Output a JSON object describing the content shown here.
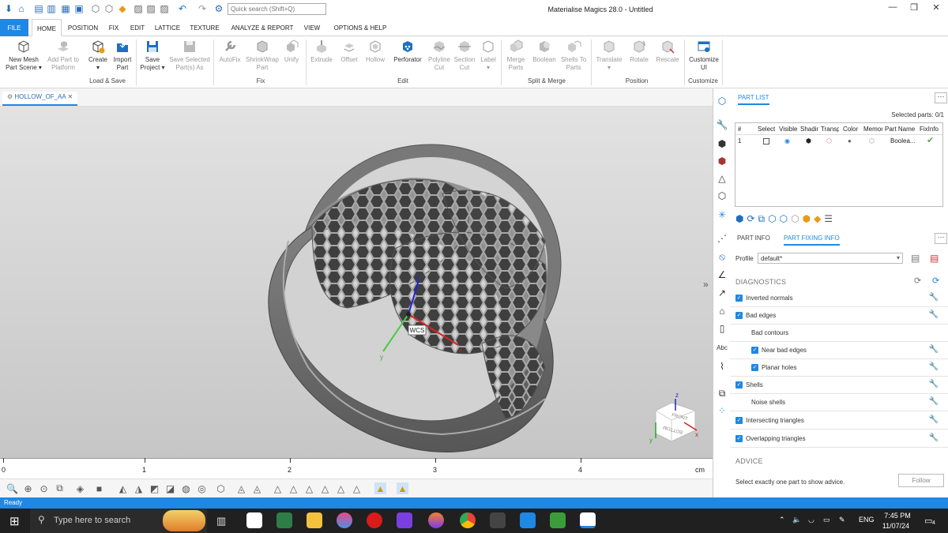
{
  "titlebar": {
    "title": "Materialise Magics 28.0 - Untitled",
    "search_placeholder": "Quick search (Shift+Q)",
    "minimize": "—",
    "restore": "❐",
    "close": "✕"
  },
  "tabs": [
    "FILE",
    "HOME",
    "POSITION",
    "FIX",
    "EDIT",
    "LATTICE",
    "TEXTURE",
    "ANALYZE & REPORT",
    "VIEW",
    "OPTIONS & HELP"
  ],
  "ribbon": {
    "buttons": [
      {
        "line1": "New Mesh",
        "line2": "Part Scene ▾"
      },
      {
        "line1": "Add Part to",
        "line2": "Platform"
      },
      {
        "line1": "Create",
        "line2": "▾"
      },
      {
        "line1": "Import",
        "line2": "Part"
      },
      {
        "line1": "Save",
        "line2": "Project ▾"
      },
      {
        "line1": "Save Selected",
        "line2": "Part(s) As"
      },
      {
        "line1": "AutoFix",
        "line2": ""
      },
      {
        "line1": "ShrinkWrap",
        "line2": "Part"
      },
      {
        "line1": "Unify",
        "line2": ""
      },
      {
        "line1": "Extrude",
        "line2": ""
      },
      {
        "line1": "Offset",
        "line2": ""
      },
      {
        "line1": "Hollow",
        "line2": ""
      },
      {
        "line1": "Perforator",
        "line2": ""
      },
      {
        "line1": "Polyline",
        "line2": "Cut"
      },
      {
        "line1": "Section",
        "line2": "Cut"
      },
      {
        "line1": "Label",
        "line2": "▾"
      },
      {
        "line1": "Merge",
        "line2": "Parts"
      },
      {
        "line1": "Boolean",
        "line2": ""
      },
      {
        "line1": "Shells To",
        "line2": "Parts"
      },
      {
        "line1": "Translate",
        "line2": "▾"
      },
      {
        "line1": "Rotate",
        "line2": ""
      },
      {
        "line1": "Rescale",
        "line2": ""
      },
      {
        "line1": "Customize",
        "line2": "UI"
      }
    ],
    "groups": [
      "Load & Save",
      "Fix",
      "Edit",
      "Split & Merge",
      "Position",
      "Customize"
    ]
  },
  "document_tab": "HOLLOW_OF_AA",
  "viewport": {
    "wcs_label": "WCS",
    "axis_x": "x",
    "axis_y": "y",
    "axis_z": "z",
    "cube_front": "FRONT",
    "cube_bottom": "BOTTOM",
    "collapse_arrow": "»"
  },
  "ruler": {
    "labels": [
      "0",
      "1",
      "2",
      "3",
      "4"
    ],
    "unit": "cm"
  },
  "status": "Ready",
  "panel": {
    "part_list_tab": "PART LIST",
    "selected_parts": "Selected parts:  0/1",
    "columns": [
      "#",
      "Select",
      "Visible",
      "Shading",
      "Transparency",
      "Color",
      "Memory",
      "Part Name",
      "FixInfo"
    ],
    "row": {
      "index": "1",
      "name": "Boolea...",
      "fixinfo": "✔"
    },
    "tabs": [
      "PART INFO",
      "PART FIXING INFO"
    ],
    "profile_label": "Profile",
    "profile_value": "default*",
    "diagnostics_title": "DIAGNOSTICS",
    "diagnostics": [
      {
        "label": "Inverted normals",
        "checked": true,
        "indent": 0,
        "wrench": true
      },
      {
        "label": "Bad edges",
        "checked": true,
        "indent": 0,
        "wrench": true
      },
      {
        "label": "Bad contours",
        "checked": false,
        "indent": 1,
        "wrench": false
      },
      {
        "label": "Near bad edges",
        "checked": true,
        "indent": 2,
        "wrench": true
      },
      {
        "label": "Planar holes",
        "checked": true,
        "indent": 2,
        "wrench": true
      },
      {
        "label": "Shells",
        "checked": true,
        "indent": 0,
        "wrench": true
      },
      {
        "label": "Noise shells",
        "checked": false,
        "indent": 1,
        "wrench": true
      },
      {
        "label": "Intersecting triangles",
        "checked": true,
        "indent": 0,
        "wrench": true
      },
      {
        "label": "Overlapping triangles",
        "checked": true,
        "indent": 0,
        "wrench": true
      }
    ],
    "advice_title": "ADVICE",
    "advice_text": "Select exactly one part to show advice.",
    "follow_label": "Follow"
  },
  "taskbar": {
    "search_placeholder": "Type here to search",
    "time": "7:45 PM",
    "date": "11/07/24",
    "lang": "ENG",
    "notifications": "4"
  },
  "colors": {
    "accent": "#1e88e5",
    "part": "#6e6e6e",
    "viewport_top": "#e2e2e2"
  }
}
